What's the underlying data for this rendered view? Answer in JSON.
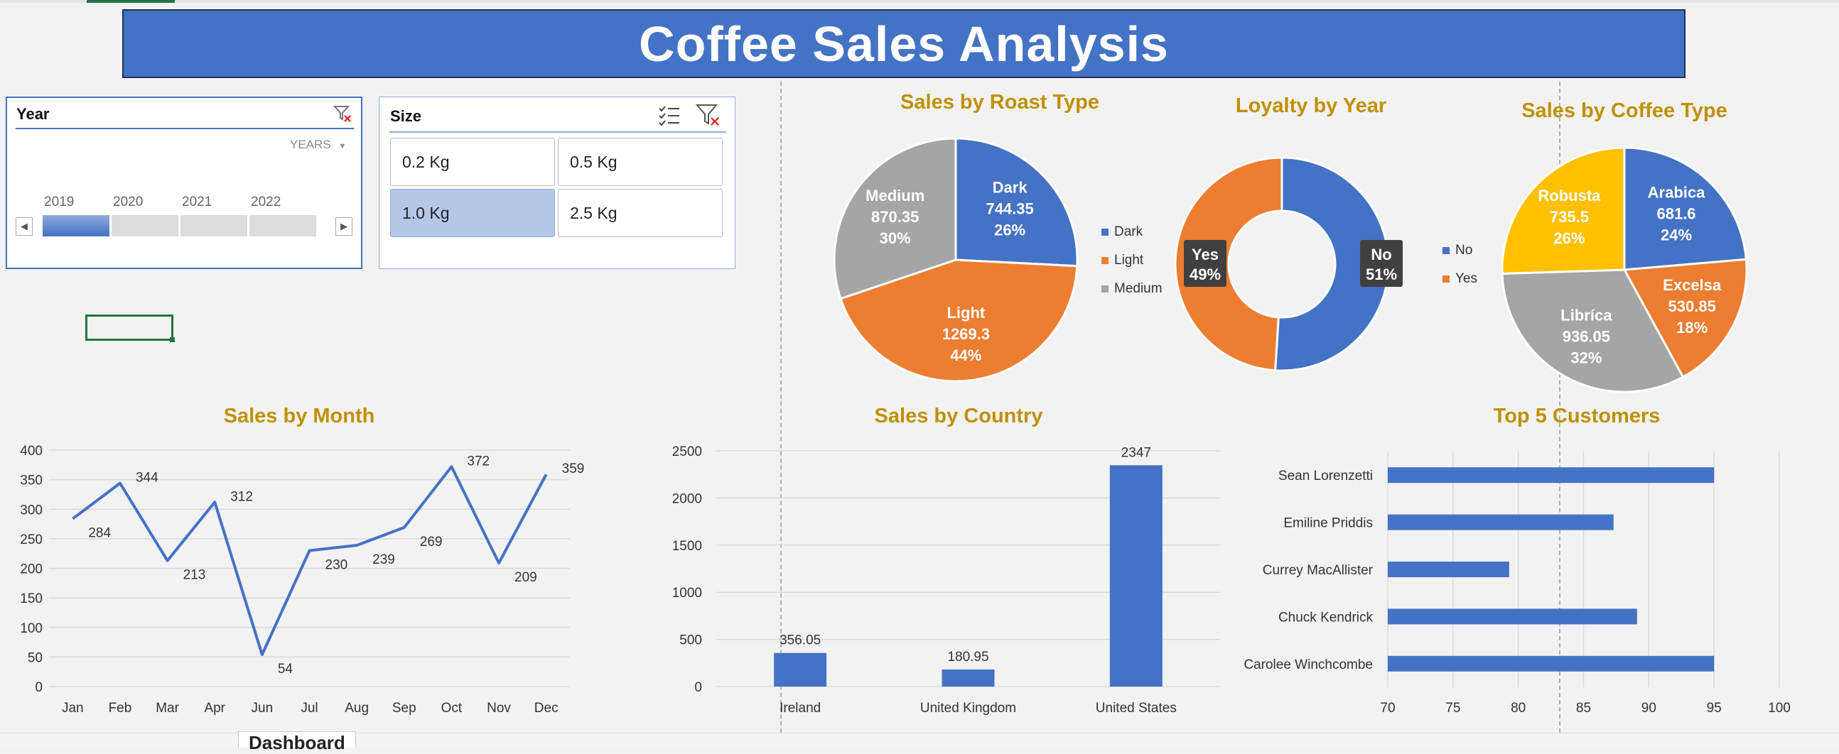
{
  "banner": {
    "title": "Coffee Sales Analysis"
  },
  "slicers": {
    "year": {
      "title": "Year",
      "level_label": "YEARS",
      "years": [
        "2019",
        "2020",
        "2021",
        "2022"
      ],
      "selected_year": "2019"
    },
    "size": {
      "title": "Size",
      "options": [
        "0.2 Kg",
        "0.5 Kg",
        "1.0 Kg",
        "2.5 Kg"
      ],
      "selected": "1.0 Kg"
    }
  },
  "colors": {
    "blue": "#4472c4",
    "orange": "#ed7d31",
    "gray": "#a5a5a5",
    "gold": "#ffc000",
    "title_gold": "#bf9000"
  },
  "icons": {
    "clear_filter": "filter-clear-icon",
    "multi_select": "multi-select-icon",
    "scroll_left": "arrow-left-icon",
    "scroll_right": "arrow-right-icon"
  },
  "sheet_tab": {
    "active": "Dashboard"
  },
  "chart_data": [
    {
      "type": "pie",
      "title": "Sales by Roast Type",
      "categories": [
        "Dark",
        "Light",
        "Medium"
      ],
      "values": [
        744.35,
        1269.3,
        870.35
      ],
      "percent_labels": [
        "26%",
        "44%",
        "30%"
      ],
      "value_labels": [
        "744.35",
        "1269.3",
        "870.35"
      ],
      "colors": [
        "#4472c4",
        "#ed7d31",
        "#a5a5a5"
      ],
      "legend": "right"
    },
    {
      "type": "pie",
      "subtype": "doughnut",
      "title": "Loyalty by Year",
      "categories": [
        "No",
        "Yes"
      ],
      "percent_labels": [
        "51%",
        "49%"
      ],
      "values": [
        51,
        49
      ],
      "colors": [
        "#4472c4",
        "#ed7d31"
      ],
      "legend": "left"
    },
    {
      "type": "pie",
      "title": "Sales by Coffee Type",
      "categories": [
        "Arabica",
        "Excelsa",
        "Libríca",
        "Robusta"
      ],
      "values": [
        681.6,
        530.85,
        936.05,
        735.5
      ],
      "value_labels": [
        "681.6",
        "530.85",
        "936.05",
        "735.5"
      ],
      "percent_labels": [
        "24%",
        "18%",
        "32%",
        "26%"
      ],
      "colors": [
        "#4472c4",
        "#ed7d31",
        "#a5a5a5",
        "#ffc000"
      ]
    },
    {
      "type": "line",
      "title": "Sales by Month",
      "categories": [
        "Jan",
        "Feb",
        "Mar",
        "Apr",
        "Jun",
        "Jul",
        "Aug",
        "Sep",
        "Oct",
        "Nov",
        "Dec"
      ],
      "values": [
        284,
        344,
        213,
        312,
        54,
        230,
        239,
        269,
        372,
        209,
        359
      ],
      "ylim": [
        0,
        400
      ],
      "yticks": [
        "0",
        "50",
        "100",
        "150",
        "200",
        "250",
        "300",
        "350",
        "400"
      ],
      "grid": true,
      "color": "#4472c4"
    },
    {
      "type": "bar",
      "title": "Sales by Country",
      "categories": [
        "Ireland",
        "United Kingdom",
        "United States"
      ],
      "values": [
        356.05,
        180.95,
        2347
      ],
      "value_labels": [
        "356.05",
        "180.95",
        "2347"
      ],
      "ylim": [
        0,
        2500
      ],
      "yticks": [
        "0",
        "500",
        "1000",
        "1500",
        "2000",
        "2500"
      ],
      "grid": true,
      "color": "#4472c4"
    },
    {
      "type": "bar",
      "orientation": "horizontal",
      "title": "Top 5 Customers",
      "categories": [
        "Sean Lorenzetti",
        "Emiline Priddis",
        "Currey MacAllister",
        "Chuck Kendrick",
        "Carolee Winchcombe"
      ],
      "values": [
        95,
        87.3,
        79.3,
        89.1,
        95
      ],
      "xlim": [
        70,
        100
      ],
      "xticks": [
        "70",
        "75",
        "80",
        "85",
        "90",
        "95",
        "100"
      ],
      "grid": true,
      "color": "#4472c4"
    }
  ]
}
